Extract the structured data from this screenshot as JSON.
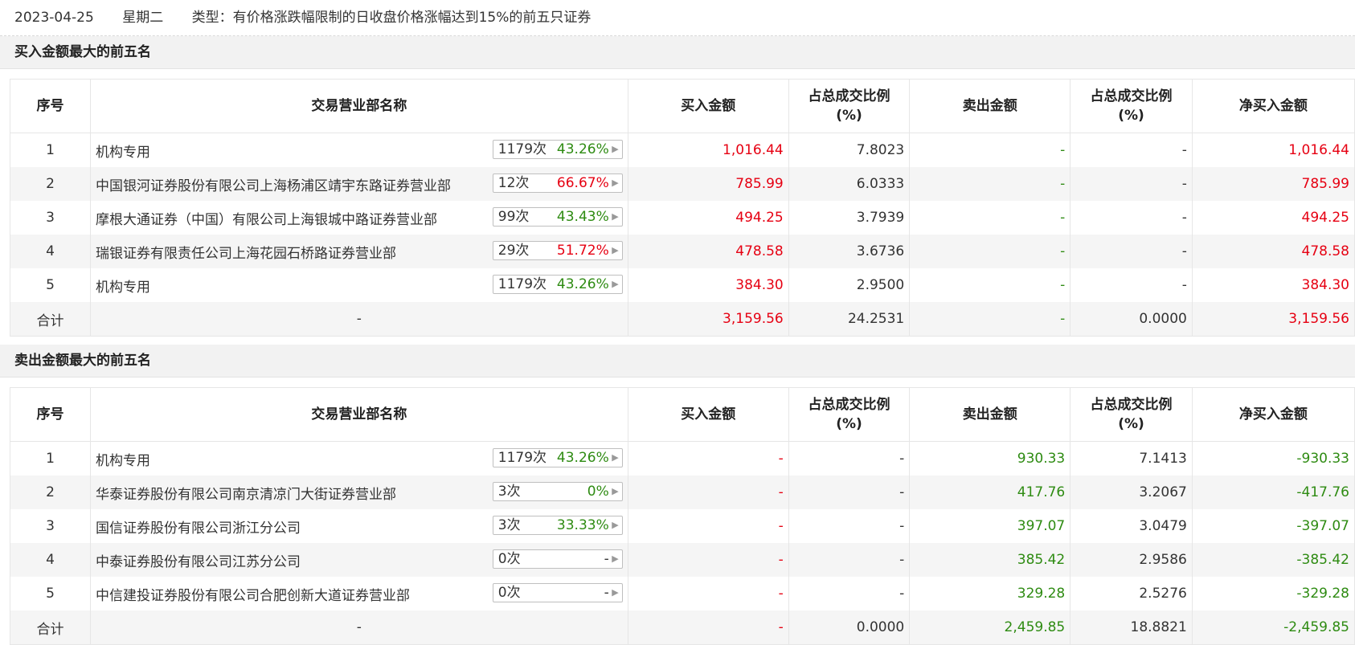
{
  "header": {
    "date": "2023-04-25",
    "weekday": "星期二",
    "type": "类型：有价格涨跌幅限制的日收盘价格涨幅达到15%的前五只证券"
  },
  "columns": {
    "seq": "序号",
    "name": "交易营业部名称",
    "buy": "买入金额",
    "buy_pct_line1": "占总成交比例",
    "buy_pct_line2": "(%)",
    "sell": "卖出金额",
    "sell_pct_line1": "占总成交比例",
    "sell_pct_line2": "(%)",
    "net": "净买入金额"
  },
  "buy_section": {
    "title": "买入金额最大的前五名",
    "rows": [
      {
        "seq": "1",
        "name": "机构专用",
        "count": "1179次",
        "rate": "43.26%",
        "rate_color": "green",
        "buy": "1,016.44",
        "buy_pct": "7.8023",
        "sell": "-",
        "sell_pct": "-",
        "net": "1,016.44"
      },
      {
        "seq": "2",
        "name": "中国银河证券股份有限公司上海杨浦区靖宇东路证券营业部",
        "count": "12次",
        "rate": "66.67%",
        "rate_color": "red",
        "buy": "785.99",
        "buy_pct": "6.0333",
        "sell": "-",
        "sell_pct": "-",
        "net": "785.99"
      },
      {
        "seq": "3",
        "name": "摩根大通证券（中国）有限公司上海银城中路证券营业部",
        "count": "99次",
        "rate": "43.43%",
        "rate_color": "green",
        "buy": "494.25",
        "buy_pct": "3.7939",
        "sell": "-",
        "sell_pct": "-",
        "net": "494.25"
      },
      {
        "seq": "4",
        "name": "瑞银证券有限责任公司上海花园石桥路证券营业部",
        "count": "29次",
        "rate": "51.72%",
        "rate_color": "red",
        "buy": "478.58",
        "buy_pct": "3.6736",
        "sell": "-",
        "sell_pct": "-",
        "net": "478.58"
      },
      {
        "seq": "5",
        "name": "机构专用",
        "count": "1179次",
        "rate": "43.26%",
        "rate_color": "green",
        "buy": "384.30",
        "buy_pct": "2.9500",
        "sell": "-",
        "sell_pct": "-",
        "net": "384.30"
      }
    ],
    "total": {
      "label": "合计",
      "name": "-",
      "buy": "3,159.56",
      "buy_pct": "24.2531",
      "sell": "-",
      "sell_pct": "0.0000",
      "net": "3,159.56"
    }
  },
  "sell_section": {
    "title": "卖出金额最大的前五名",
    "rows": [
      {
        "seq": "1",
        "name": "机构专用",
        "count": "1179次",
        "rate": "43.26%",
        "rate_color": "green",
        "buy": "-",
        "buy_pct": "-",
        "sell": "930.33",
        "sell_pct": "7.1413",
        "net": "-930.33"
      },
      {
        "seq": "2",
        "name": "华泰证券股份有限公司南京清凉门大街证券营业部",
        "count": "3次",
        "rate": "0%",
        "rate_color": "green",
        "buy": "-",
        "buy_pct": "-",
        "sell": "417.76",
        "sell_pct": "3.2067",
        "net": "-417.76"
      },
      {
        "seq": "3",
        "name": "国信证券股份有限公司浙江分公司",
        "count": "3次",
        "rate": "33.33%",
        "rate_color": "green",
        "buy": "-",
        "buy_pct": "-",
        "sell": "397.07",
        "sell_pct": "3.0479",
        "net": "-397.07"
      },
      {
        "seq": "4",
        "name": "中泰证券股份有限公司江苏分公司",
        "count": "0次",
        "rate": "-",
        "rate_color": "dark",
        "buy": "-",
        "buy_pct": "-",
        "sell": "385.42",
        "sell_pct": "2.9586",
        "net": "-385.42"
      },
      {
        "seq": "5",
        "name": "中信建投证券股份有限公司合肥创新大道证券营业部",
        "count": "0次",
        "rate": "-",
        "rate_color": "dark",
        "buy": "-",
        "buy_pct": "-",
        "sell": "329.28",
        "sell_pct": "2.5276",
        "net": "-329.28"
      }
    ],
    "total": {
      "label": "合计",
      "name": "-",
      "buy": "-",
      "buy_pct": "0.0000",
      "sell": "2,459.85",
      "sell_pct": "18.8821",
      "net": "-2,459.85"
    }
  },
  "colors": {
    "up": "#e60012",
    "down": "#2e8b12",
    "dark": "#333333"
  }
}
